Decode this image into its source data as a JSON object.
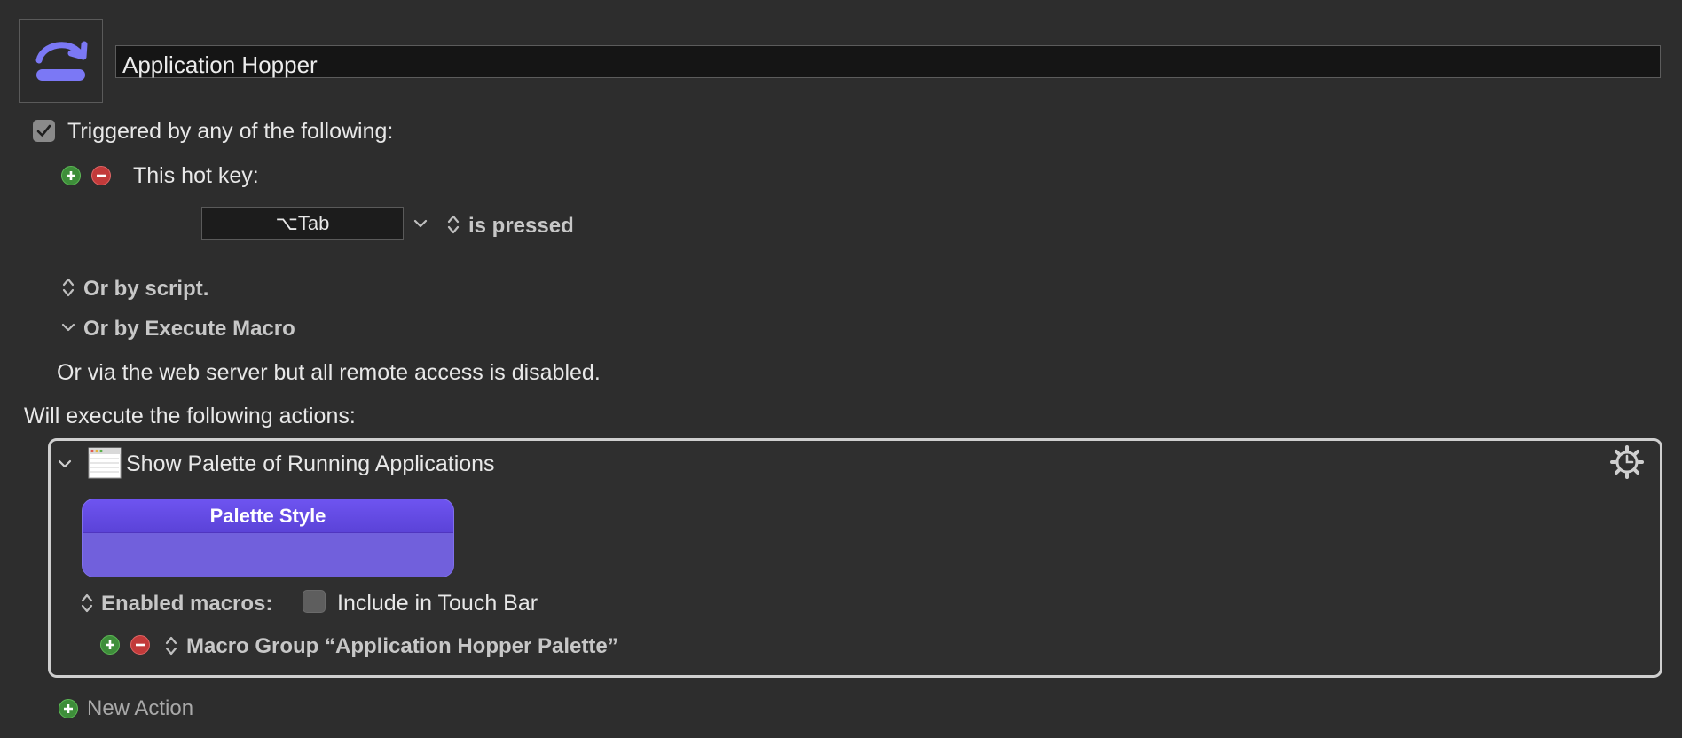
{
  "macro": {
    "name": "Application Hopper",
    "icon": "hop-arrow-icon",
    "accent": "#7b78f5"
  },
  "trigger": {
    "triggered_label": "Triggered by any of the following:",
    "hotkey_label": "This hot key:",
    "hotkey_value": "⌥Tab",
    "hotkey_condition": "is pressed",
    "or_script_label": "Or by script.",
    "or_execute_label": "Or by Execute Macro",
    "web_server_text": "Or via the web server but all remote access is disabled."
  },
  "actions": {
    "header": "Will execute the following actions:",
    "items": [
      {
        "title": "Show Palette of Running Applications",
        "palette_style_label": "Palette Style",
        "enabled_macros_label": "Enabled macros:",
        "include_touchbar_label": "Include in Touch Bar",
        "macro_group_label": "Macro Group “Application Hopper Palette”"
      }
    ],
    "new_action_label": "New Action"
  },
  "colors": {
    "background": "#2d2d2d",
    "add_green": "#3e8e3a",
    "remove_red": "#c23a3a",
    "palette_purple": "#6e54f0"
  }
}
